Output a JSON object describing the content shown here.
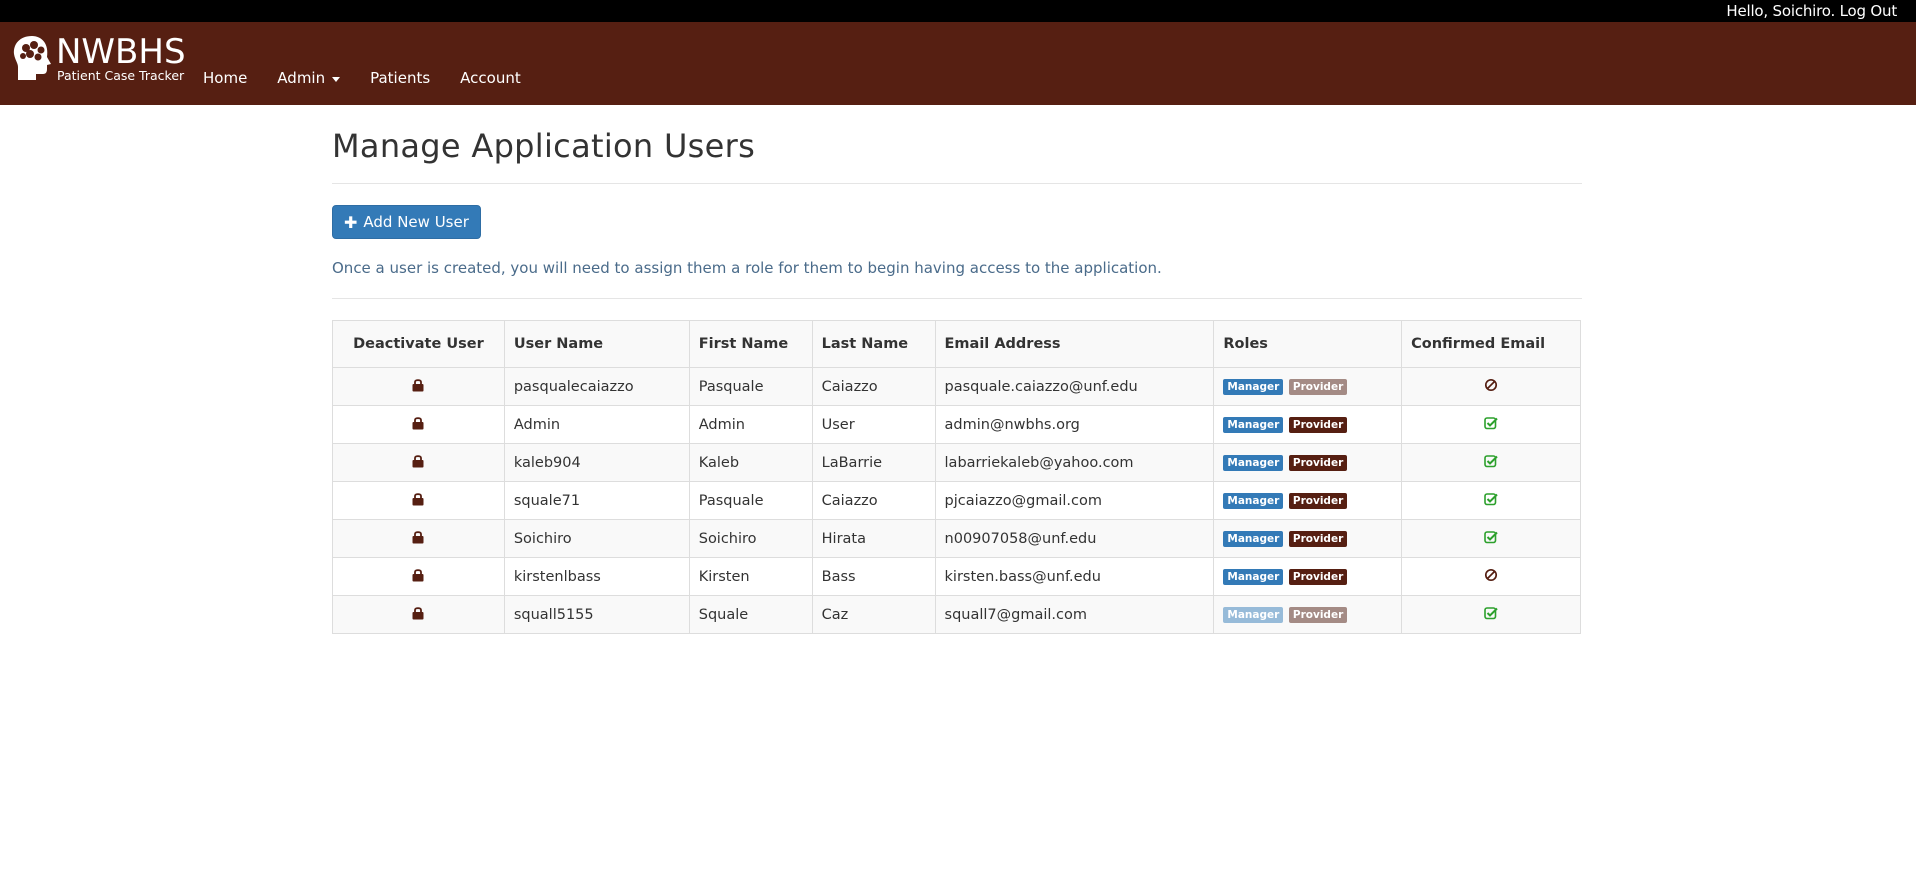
{
  "topbar": {
    "greeting": "Hello, Soichiro.",
    "logout_label": "Log Out"
  },
  "brand": {
    "title": "NWBHS",
    "subtitle": "Patient Case Tracker",
    "icon": "brain-head-icon"
  },
  "nav": {
    "items": [
      {
        "label": "Home"
      },
      {
        "label": "Admin",
        "dropdown": true
      },
      {
        "label": "Patients"
      },
      {
        "label": "Account"
      }
    ]
  },
  "page": {
    "title": "Manage Application Users",
    "add_button_label": "Add New User",
    "hint": "Once a user is created, you will need to assign them a role for them to begin having access to the application."
  },
  "table": {
    "headers": [
      "Deactivate User",
      "User Name",
      "First Name",
      "Last Name",
      "Email Address",
      "Roles",
      "Confirmed Email"
    ],
    "role_labels": {
      "manager": "Manager",
      "provider": "Provider"
    },
    "rows": [
      {
        "username": "pasqualecaiazzo",
        "first": "Pasquale",
        "last": "Caiazzo",
        "email": "pasquale.caiazzo@unf.edu",
        "manager": true,
        "provider": false,
        "confirmed": false
      },
      {
        "username": "Admin",
        "first": "Admin",
        "last": "User",
        "email": "admin@nwbhs.org",
        "manager": true,
        "provider": true,
        "confirmed": true
      },
      {
        "username": "kaleb904",
        "first": "Kaleb",
        "last": "LaBarrie",
        "email": "labarriekaleb@yahoo.com",
        "manager": true,
        "provider": true,
        "confirmed": true
      },
      {
        "username": "squale71",
        "first": "Pasquale",
        "last": "Caiazzo",
        "email": "pjcaiazzo@gmail.com",
        "manager": true,
        "provider": true,
        "confirmed": true
      },
      {
        "username": "Soichiro",
        "first": "Soichiro",
        "last": "Hirata",
        "email": "n00907058@unf.edu",
        "manager": true,
        "provider": true,
        "confirmed": true
      },
      {
        "username": "kirstenlbass",
        "first": "Kirsten",
        "last": "Bass",
        "email": "kirsten.bass@unf.edu",
        "manager": true,
        "provider": true,
        "confirmed": false
      },
      {
        "username": "squall5155",
        "first": "Squale",
        "last": "Caz",
        "email": "squall7@gmail.com",
        "manager": false,
        "provider": false,
        "confirmed": true
      }
    ]
  },
  "colors": {
    "navbar": "#561f12",
    "primary": "#337ab7",
    "confirmed": "#2ca02c",
    "unconfirmed": "#561f12"
  }
}
